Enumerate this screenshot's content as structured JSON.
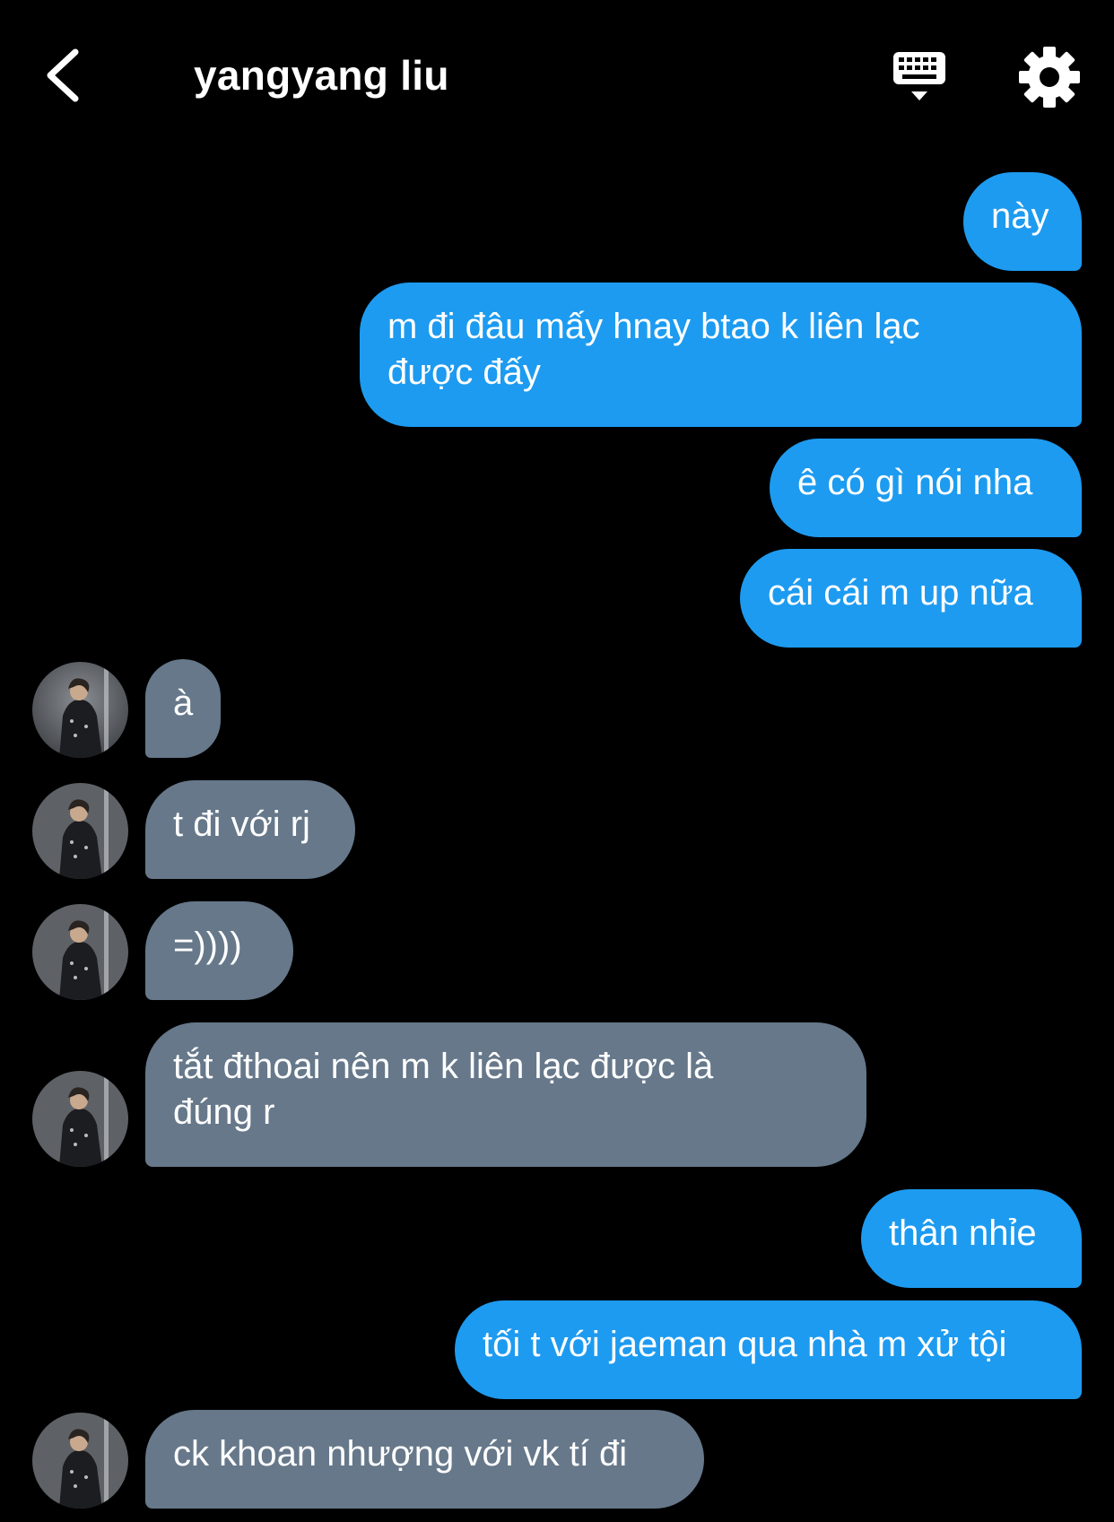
{
  "header": {
    "title": "yangyang liu",
    "back_icon": "chevron-left-icon",
    "keyboard_icon": "keyboard-icon",
    "settings_icon": "gear-icon"
  },
  "colors": {
    "background": "#000000",
    "outgoing_bubble": "#1d9bf0",
    "incoming_bubble": "#66788a",
    "text": "#ffffff"
  },
  "messages": [
    {
      "direction": "out",
      "text": "này"
    },
    {
      "direction": "out",
      "text": "m đi đâu mấy hnay btao k liên lạc\nđược đấy"
    },
    {
      "direction": "out",
      "text": "ê có gì nói nha"
    },
    {
      "direction": "out",
      "text": "cái cái m up nữa"
    },
    {
      "direction": "in",
      "text": "à"
    },
    {
      "direction": "in",
      "text": "t đi với rj"
    },
    {
      "direction": "in",
      "text": "=))))"
    },
    {
      "direction": "in",
      "text": "tắt đthoai nên m k liên lạc được là\nđúng r"
    },
    {
      "direction": "out",
      "text": "thân nhỉe"
    },
    {
      "direction": "out",
      "text": "tối t với jaeman qua nhà m xử tội"
    },
    {
      "direction": "in",
      "text": "ck khoan nhượng với vk tí đi"
    }
  ]
}
